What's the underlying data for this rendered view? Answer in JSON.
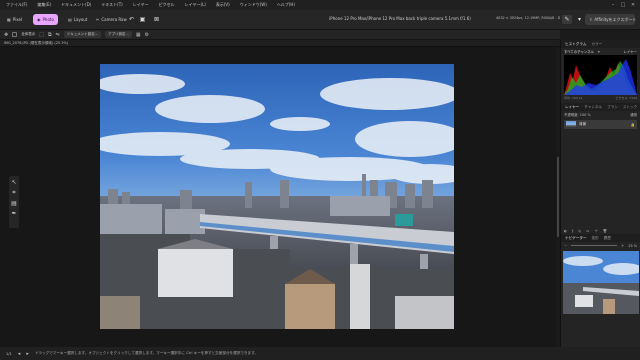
{
  "menubar": {
    "items": [
      "ファイル(F)",
      "編集(E)",
      "ドキュメント(D)",
      "テキスト(T)",
      "レイヤー",
      "ピクセル",
      "レイヤー(L)",
      "表示(V)",
      "ウィンドウ(W)",
      "ヘルプ(H)"
    ]
  },
  "toolbar": {
    "personas": [
      {
        "label": "Pixel",
        "icon": "pixel-persona-icon"
      },
      {
        "label": "Photo",
        "icon": "photo-persona-icon",
        "active": true
      },
      {
        "label": "Layout",
        "icon": "layout-persona-icon"
      },
      {
        "label": "Camera Raw",
        "icon": "camera-raw-icon"
      }
    ],
    "document_title": "iPhone 12 Pro Max/iPhone 12 Pro Max back triple camera 5.1mm f/1.6)",
    "document_info": "4032 × 3024px, 12.19MP, RGBA/8 - Display P3",
    "accent_color": "#e9a6ff"
  },
  "context_toolbar": {
    "checkbox_label": "全体表示",
    "document_settings": "ドキュメント設定...",
    "app_settings": "アプリ設定..."
  },
  "document_tab": {
    "label": "IMG_2076.JPG (現在表示領域) (25.3%)"
  },
  "right_panel": {
    "tabs_top": [
      "ヒストグラム",
      "カラー"
    ],
    "channel_select": "すべてのチャンネル",
    "layer_select": "レイヤー",
    "hist_stats_left": "平均: 163.11",
    "hist_stats_mid": "ピクセル: 7124",
    "tabs_mid": [
      "レイヤー",
      "チャンネル",
      "ブラシ",
      "ストック"
    ],
    "opacity_label": "不透明度: 100 %",
    "blend_mode": "通常",
    "layer_name": "背景",
    "tabs_bottom": [
      "ナビゲーター",
      "変形",
      "履歴"
    ],
    "zoom_value": "25 %"
  },
  "statusbar": {
    "page": "1/1",
    "hint": "ドラッグでマーキー選択します。オブジェクトをクリックして選択します。マーキー選択中に Ctrl キーを押すと交差部分を選択できます。"
  }
}
